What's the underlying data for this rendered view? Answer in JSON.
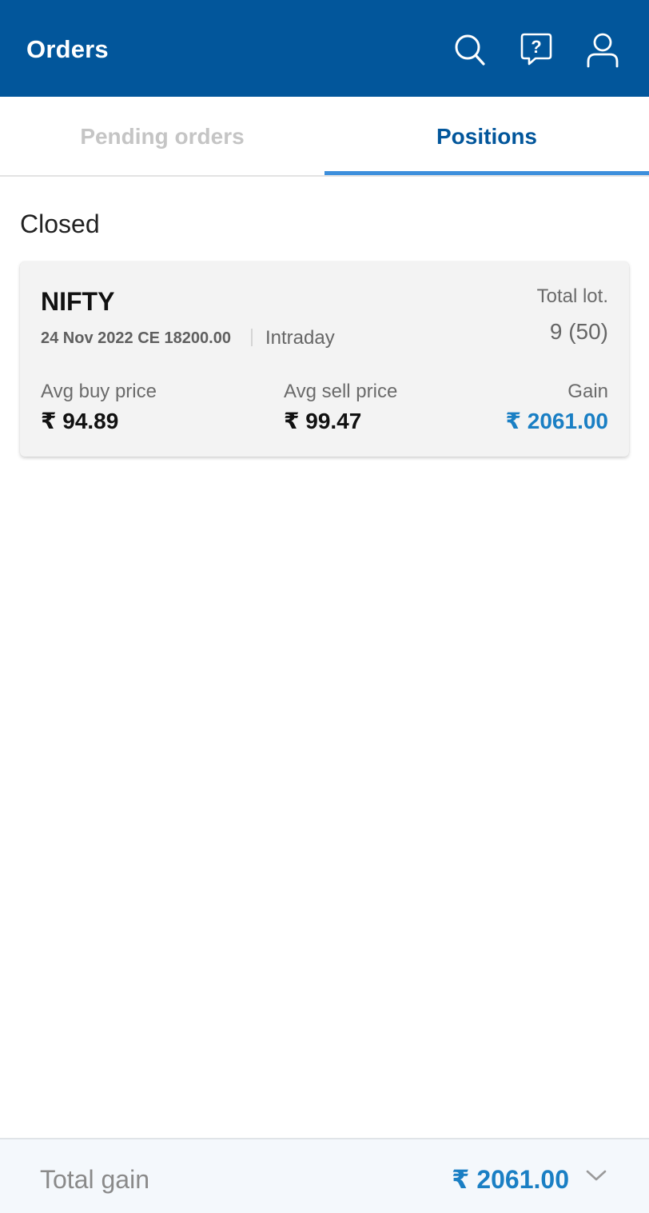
{
  "header": {
    "title": "Orders",
    "icons": [
      "search-icon",
      "help-chat-icon",
      "profile-icon"
    ]
  },
  "tabs": [
    {
      "label": "Pending orders",
      "active": false
    },
    {
      "label": "Positions",
      "active": true
    }
  ],
  "section": {
    "title": "Closed"
  },
  "position": {
    "symbol": "NIFTY",
    "contract": "24 Nov 2022 CE 18200.00",
    "product": "Intraday",
    "total_lot_label": "Total lot.",
    "total_lot_value": "9 (50)",
    "avg_buy_label": "Avg buy price",
    "avg_buy_value": "₹ 94.89",
    "avg_sell_label": "Avg sell price",
    "avg_sell_value": "₹ 99.47",
    "gain_label": "Gain",
    "gain_value": "₹ 2061.00"
  },
  "footer": {
    "label": "Total gain",
    "value": "₹ 2061.00",
    "expand_icon": "chevron-down-icon"
  },
  "colors": {
    "header_bg": "#02569b",
    "accent": "#3d8fdc",
    "gain": "#1a7fc4"
  }
}
